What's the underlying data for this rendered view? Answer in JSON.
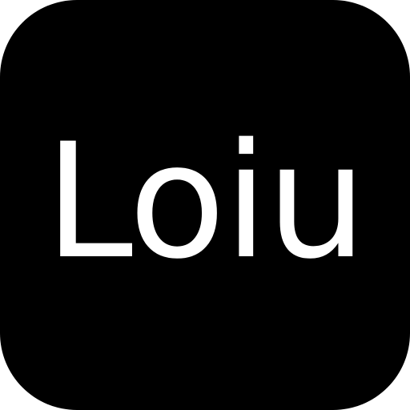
{
  "icon": {
    "label": "Loiu",
    "background_color": "#000000",
    "text_color": "#ffffff",
    "page_color": "#ffffff"
  }
}
